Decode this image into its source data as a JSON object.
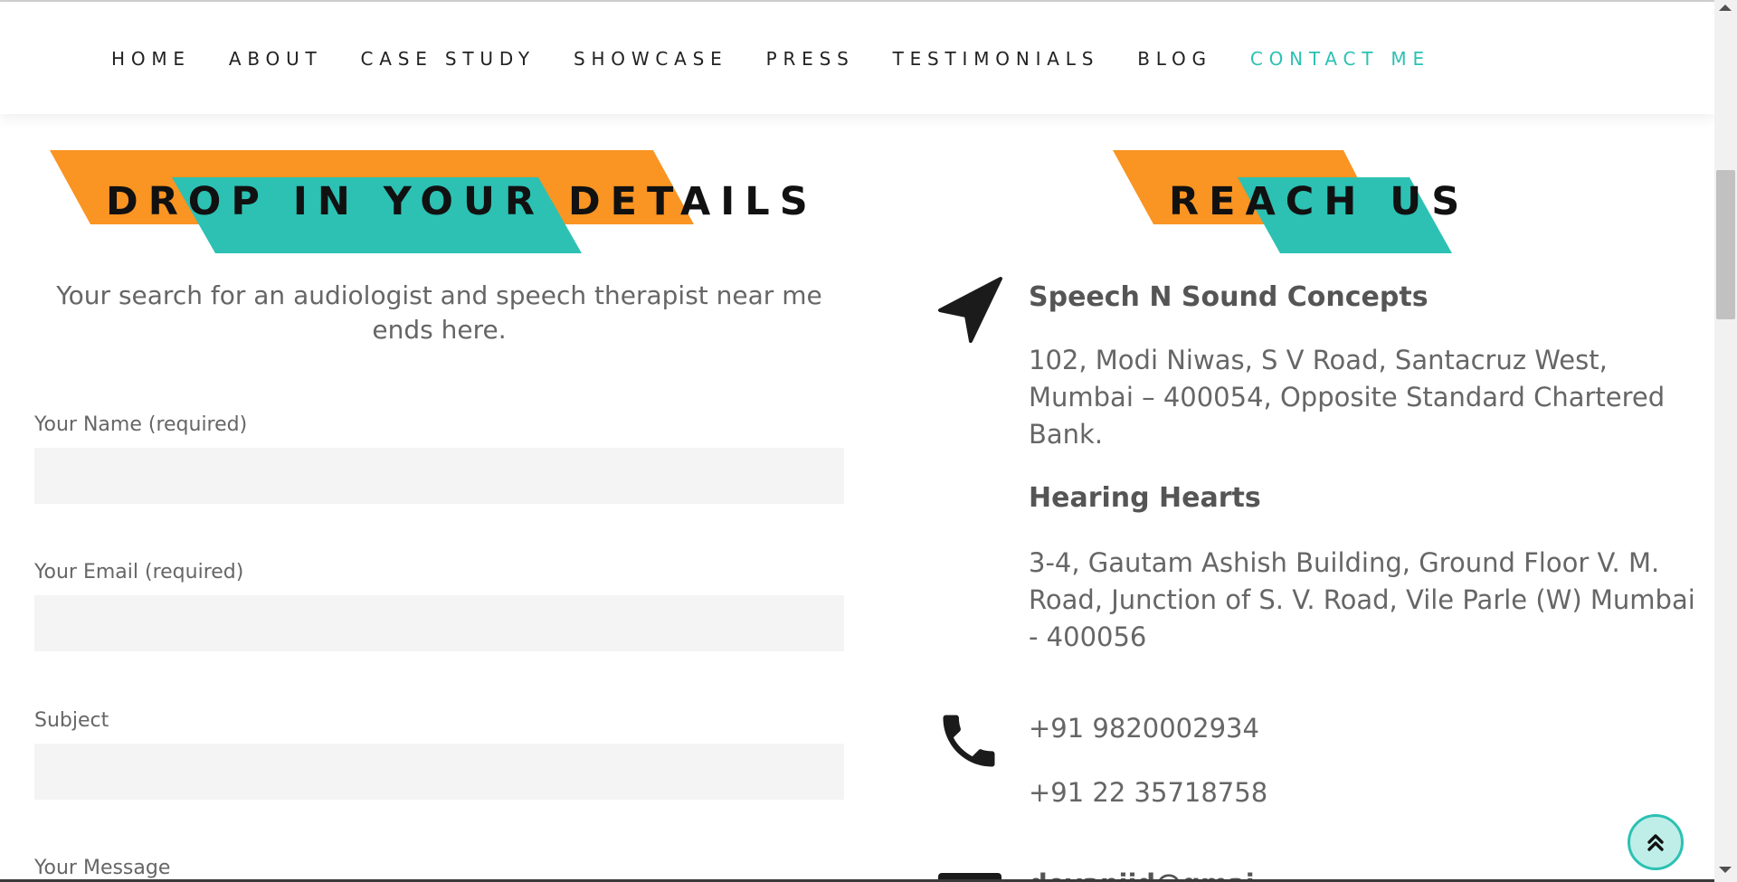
{
  "nav": {
    "items": [
      "HOME",
      "ABOUT",
      "CASE STUDY",
      "SHOWCASE",
      "PRESS",
      "TESTIMONIALS",
      "BLOG",
      "CONTACT ME"
    ],
    "active_index": 7
  },
  "form_section": {
    "heading": "DROP IN YOUR DETAILS",
    "intro": "Your search for an audiologist and speech therapist near me ends here.",
    "fields": {
      "name_label": "Your Name (required)",
      "email_label": "Your Email (required)",
      "subject_label": "Subject",
      "message_label": "Your Message"
    }
  },
  "contact_section": {
    "heading": "REACH US",
    "locations": [
      {
        "name": "Speech N Sound Concepts",
        "address": "102, Modi Niwas, S V Road, Santacruz West, Mumbai – 400054, Opposite Standard Chartered Bank."
      },
      {
        "name": "Hearing Hearts",
        "address": "3-4, Gautam Ashish Building, Ground Floor V. M. Road, Junction of S. V. Road, Vile Parle (W) Mumbai - 400056"
      }
    ],
    "phones": [
      "+91 9820002934",
      "+91 22 35718758"
    ],
    "email_partial": "devanijd@gmai..."
  },
  "colors": {
    "accent_teal": "#2cc1b3",
    "accent_orange": "#fa9422",
    "text_dark": "#111111",
    "text_muted": "#666666",
    "input_bg": "#f4f4f4"
  },
  "icons": {
    "location": "navigation-arrow-icon",
    "phone": "phone-icon",
    "email": "envelope-icon",
    "back_to_top": "double-chevron-up-icon"
  }
}
